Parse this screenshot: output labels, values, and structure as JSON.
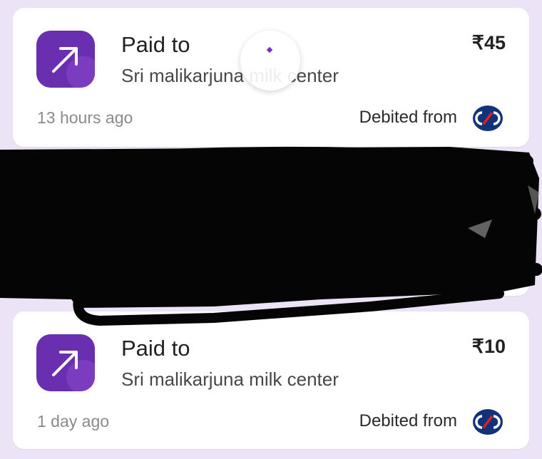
{
  "transactions": [
    {
      "title": "Paid to",
      "merchant": "Sri malikarjuna milk center",
      "amount": "₹45",
      "time": "13 hours ago",
      "debited_label": "Debited from",
      "icon": "payment-sent-arrow-icon",
      "bank_icon": "kotak-bank-logo-icon"
    },
    {
      "title": "Paid to",
      "merchant": "Sri malikarjuna milk center",
      "amount": "₹10",
      "time": "1 day ago",
      "debited_label": "Debited from",
      "icon": "payment-sent-arrow-icon",
      "bank_icon": "kotak-bank-logo-icon"
    }
  ],
  "colors": {
    "background": "#ece4f6",
    "icon_purple": "#6a2fb0",
    "bank_blue": "#12327a",
    "bank_red": "#e02020"
  }
}
